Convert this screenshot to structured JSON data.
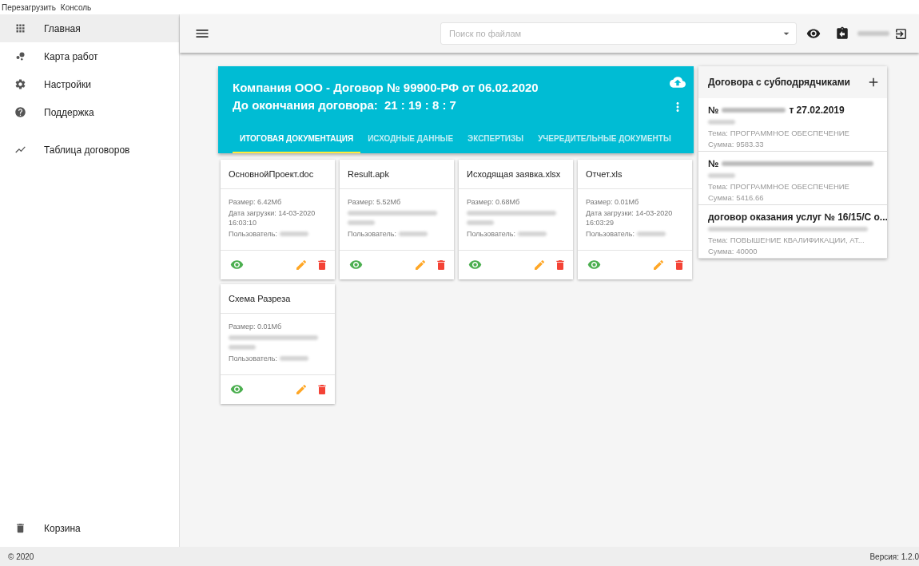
{
  "menu_bar": [
    "Перезагрузить",
    "Консоль"
  ],
  "sidebar": {
    "main_items": [
      {
        "label": "Главная",
        "selected": true
      },
      {
        "label": "Карта работ",
        "selected": false
      },
      {
        "label": "Настройки",
        "selected": false
      },
      {
        "label": "Поддержка",
        "selected": false
      }
    ],
    "extra_items": [
      {
        "label": "Таблица договоров",
        "selected": false
      }
    ],
    "bottom_item": {
      "label": "Корзина",
      "selected": false
    }
  },
  "search": {
    "placeholder": "Поиск по файлам"
  },
  "contract": {
    "title": "Компания ООО - Договор № 99900-РФ от 06.02.2020",
    "countdown_label": "До окончания договора:",
    "countdown": "21 : 19 : 8 : 7",
    "tabs": [
      {
        "label": "ИТОГОВАЯ ДОКУМЕНТАЦИЯ",
        "selected": true
      },
      {
        "label": "ИСХОДНЫЕ ДАННЫЕ",
        "selected": false
      },
      {
        "label": "ЭКСПЕРТИЗЫ",
        "selected": false
      },
      {
        "label": "УЧЕРЕДИТЕЛЬНЫЕ ДОКУМЕНТЫ",
        "selected": false
      }
    ]
  },
  "files": [
    {
      "name": "ОсновнойПроект.doc",
      "lines": [
        {
          "kind": "text",
          "text": "Размер: 6.42Мб"
        },
        {
          "kind": "text",
          "text": "Дата загрузки: 14-03-2020 16:03:10"
        },
        {
          "kind": "user",
          "text": "Пользователь:"
        }
      ]
    },
    {
      "name": "Result.apk",
      "lines": [
        {
          "kind": "text",
          "text": "Размер: 5.52Мб"
        },
        {
          "kind": "blur"
        },
        {
          "kind": "user",
          "text": "Пользователь:"
        }
      ]
    },
    {
      "name": "Исходящая заявка.xlsx",
      "lines": [
        {
          "kind": "text",
          "text": "Размер: 0.68Мб"
        },
        {
          "kind": "blur"
        },
        {
          "kind": "user",
          "text": "Пользователь:"
        }
      ]
    },
    {
      "name": "Отчет.xls",
      "lines": [
        {
          "kind": "text",
          "text": "Размер: 0.01Мб"
        },
        {
          "kind": "text",
          "text": "Дата загрузки: 14-03-2020 16:03:29"
        },
        {
          "kind": "user",
          "text": "Пользователь:"
        }
      ]
    },
    {
      "name": "Схема Разреза",
      "lines": [
        {
          "kind": "text",
          "text": "Размер: 0.01Мб"
        },
        {
          "kind": "blur"
        },
        {
          "kind": "user",
          "text": "Пользователь:"
        }
      ]
    }
  ],
  "subcontracts": {
    "title": "Договора с субподрядчиками",
    "items": [
      {
        "prefix": "№",
        "suffix": "т 27.02.2019",
        "kind": "blurred",
        "topic": "Тема: ПРОГРАММНОЕ ОБЕСПЕЧЕНИЕ",
        "sum": "Сумма: 9583.33"
      },
      {
        "prefix": "№",
        "kind": "blurred",
        "topic": "Тема: ПРОГРАММНОЕ ОБЕСПЕЧЕНИЕ",
        "sum": "Сумма: 5416.66"
      },
      {
        "prefix": "договор оказания услуг № 16/15/С о...",
        "kind": "plain",
        "topic": "Тема: ПОВЫШЕНИЕ КВАЛИФИКАЦИИ, АТ...",
        "sum": "Сумма: 40000"
      }
    ]
  },
  "footer": {
    "copyright": "© 2020",
    "version": "Версия: 1.2.0"
  }
}
